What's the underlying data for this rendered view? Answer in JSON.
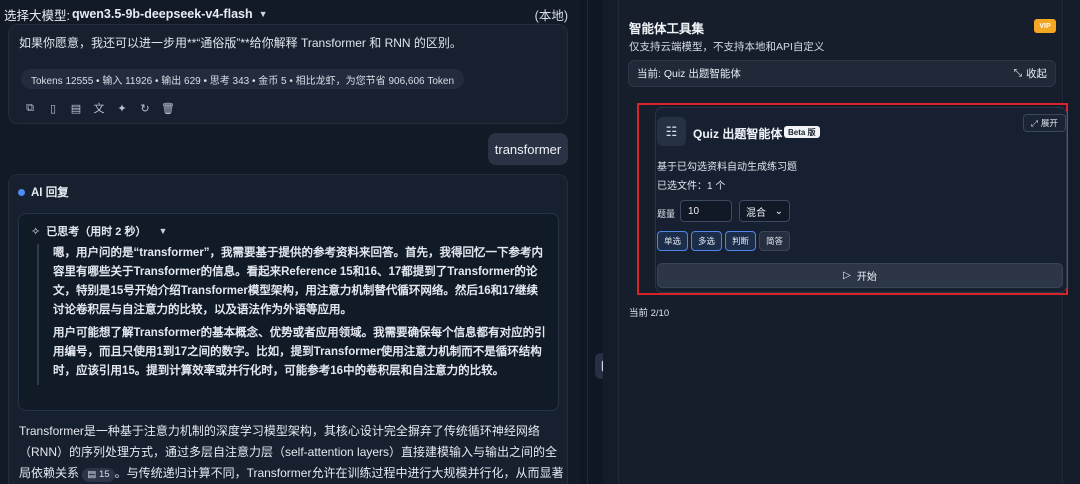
{
  "topbar": {
    "label": "选择大模型:",
    "model": "qwen3.5-9b-deepseek-v4-flash",
    "badge": "(本地)"
  },
  "prev_message": {
    "text": "如果你愿意，我还可以进一步用**“通俗版”**给你解释 Transformer 和 RNN 的区别。",
    "tokens": "Tokens 12555 • 输入 11926 • 输出 629 • 思考 343 • 金币 5 • 相比龙虾，为您节省 906,606 Token",
    "action_icons": [
      "copy-icon",
      "split-icon",
      "doc-icon",
      "translate-icon",
      "sparkle-icon",
      "refresh-icon",
      "trash-icon"
    ]
  },
  "user_message": {
    "text": "transformer"
  },
  "ai": {
    "header": "AI 回复",
    "thinking_title": "已思考（用时 2 秒）",
    "thinking_p1": "嗯，用户问的是“transformer”，我需要基于提供的参考资料来回答。首先，我得回忆一下参考内容里有哪些关于Transformer的信息。看起来Reference 15和16、17都提到了Transformer的论文，特别是15号开始介绍Transformer模型架构，用注意力机制替代循环网络。然后16和17继续讨论卷积层与自注意力的比较，以及语法作为外语等应用。",
    "thinking_p2": "用户可能想了解Transformer的基本概念、优势或者应用领域。我需要确保每个信息都有对应的引用编号，而且只使用1到17之间的数字。比如，提到Transformer使用注意力机制而不是循环结构时，应该引用15。提到计算效率或并行化时，可能参考16中的卷积层和自注意力的比较。",
    "answer_a": "Transformer是一种基于注意力机制的深度学习模型架构，其核心设计完全摒弃了传统循环神经网络（RNN）的序列处理方式，通过多层自注意力层（self-attention layers）直接建模输入与输出之间的全局依赖关系",
    "cite": "15",
    "answer_b": "。与传统递归计算不同，Transformer允许在训练过程中进行大规模并行化，从而显著提"
  },
  "panel": {
    "title": "智能体工具集",
    "vip": "VIP",
    "subtitle": "仅支持云端模型，不支持本地和API自定义",
    "current": "当前: Quiz 出题智能体",
    "collapse": "收起",
    "quiz": {
      "title": "Quiz 出题智能体",
      "beta": "Beta 版",
      "expand": "展开",
      "desc": "基于已勾选资料自动生成练习题",
      "files": "已选文件：1 个",
      "count_label": "题量",
      "count_value": "10",
      "mode": "混合",
      "types": [
        "单选",
        "多选",
        "判断",
        "简答"
      ],
      "start": "开始"
    },
    "progress": "当前 2/10"
  }
}
